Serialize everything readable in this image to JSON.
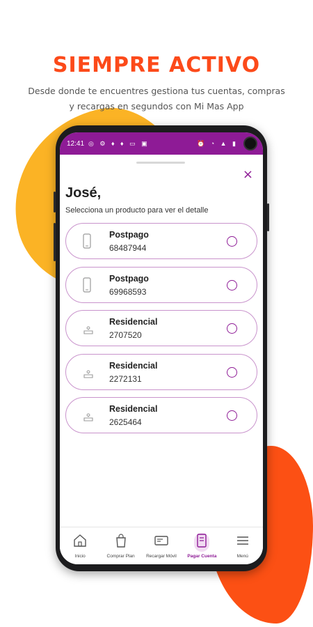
{
  "headline": "SIEMPRE ACTIVO",
  "subtitle_line1": "Desde donde te encuentres gestiona tus cuentas, compras",
  "subtitle_line2": "y recargas en segundos con Mi Mas App",
  "colors": {
    "brand_purple": "#8e1b96",
    "headline_orange": "#fc4a1a",
    "blob_yellow": "#fbb325",
    "blob_orange": "#fc5014",
    "card_border": "#c993cc"
  },
  "statusbar": {
    "time": "12:41",
    "left_icons": [
      "whatsapp-icon",
      "settings-icon",
      "bulb-icon",
      "bulb-icon",
      "tv-icon",
      "image-icon"
    ],
    "right_icons": [
      "alarm-icon",
      "wifi-icon",
      "signal-icon",
      "battery-icon"
    ]
  },
  "sheet": {
    "close_symbol": "×",
    "greeting": "José,",
    "instruction": "Selecciona un producto para ver el detalle"
  },
  "products": [
    {
      "type": "Postpago",
      "number": "68487944",
      "icon": "mobile-phone-icon"
    },
    {
      "type": "Postpago",
      "number": "69968593",
      "icon": "mobile-phone-icon"
    },
    {
      "type": "Residencial",
      "number": "2707520",
      "icon": "router-icon"
    },
    {
      "type": "Residencial",
      "number": "2272131",
      "icon": "router-icon"
    },
    {
      "type": "Residencial",
      "number": "2625464",
      "icon": "router-icon"
    }
  ],
  "nav": [
    {
      "label": "Inicio",
      "icon": "home-icon",
      "active": false
    },
    {
      "label": "Comprar Plan",
      "icon": "shopping-bag-icon",
      "active": false
    },
    {
      "label": "Recargar Móvil",
      "icon": "recharge-card-icon",
      "active": false
    },
    {
      "label": "Pagar Cuenta",
      "icon": "pay-bill-icon",
      "active": true
    },
    {
      "label": "Menú",
      "icon": "menu-icon",
      "active": false
    }
  ]
}
